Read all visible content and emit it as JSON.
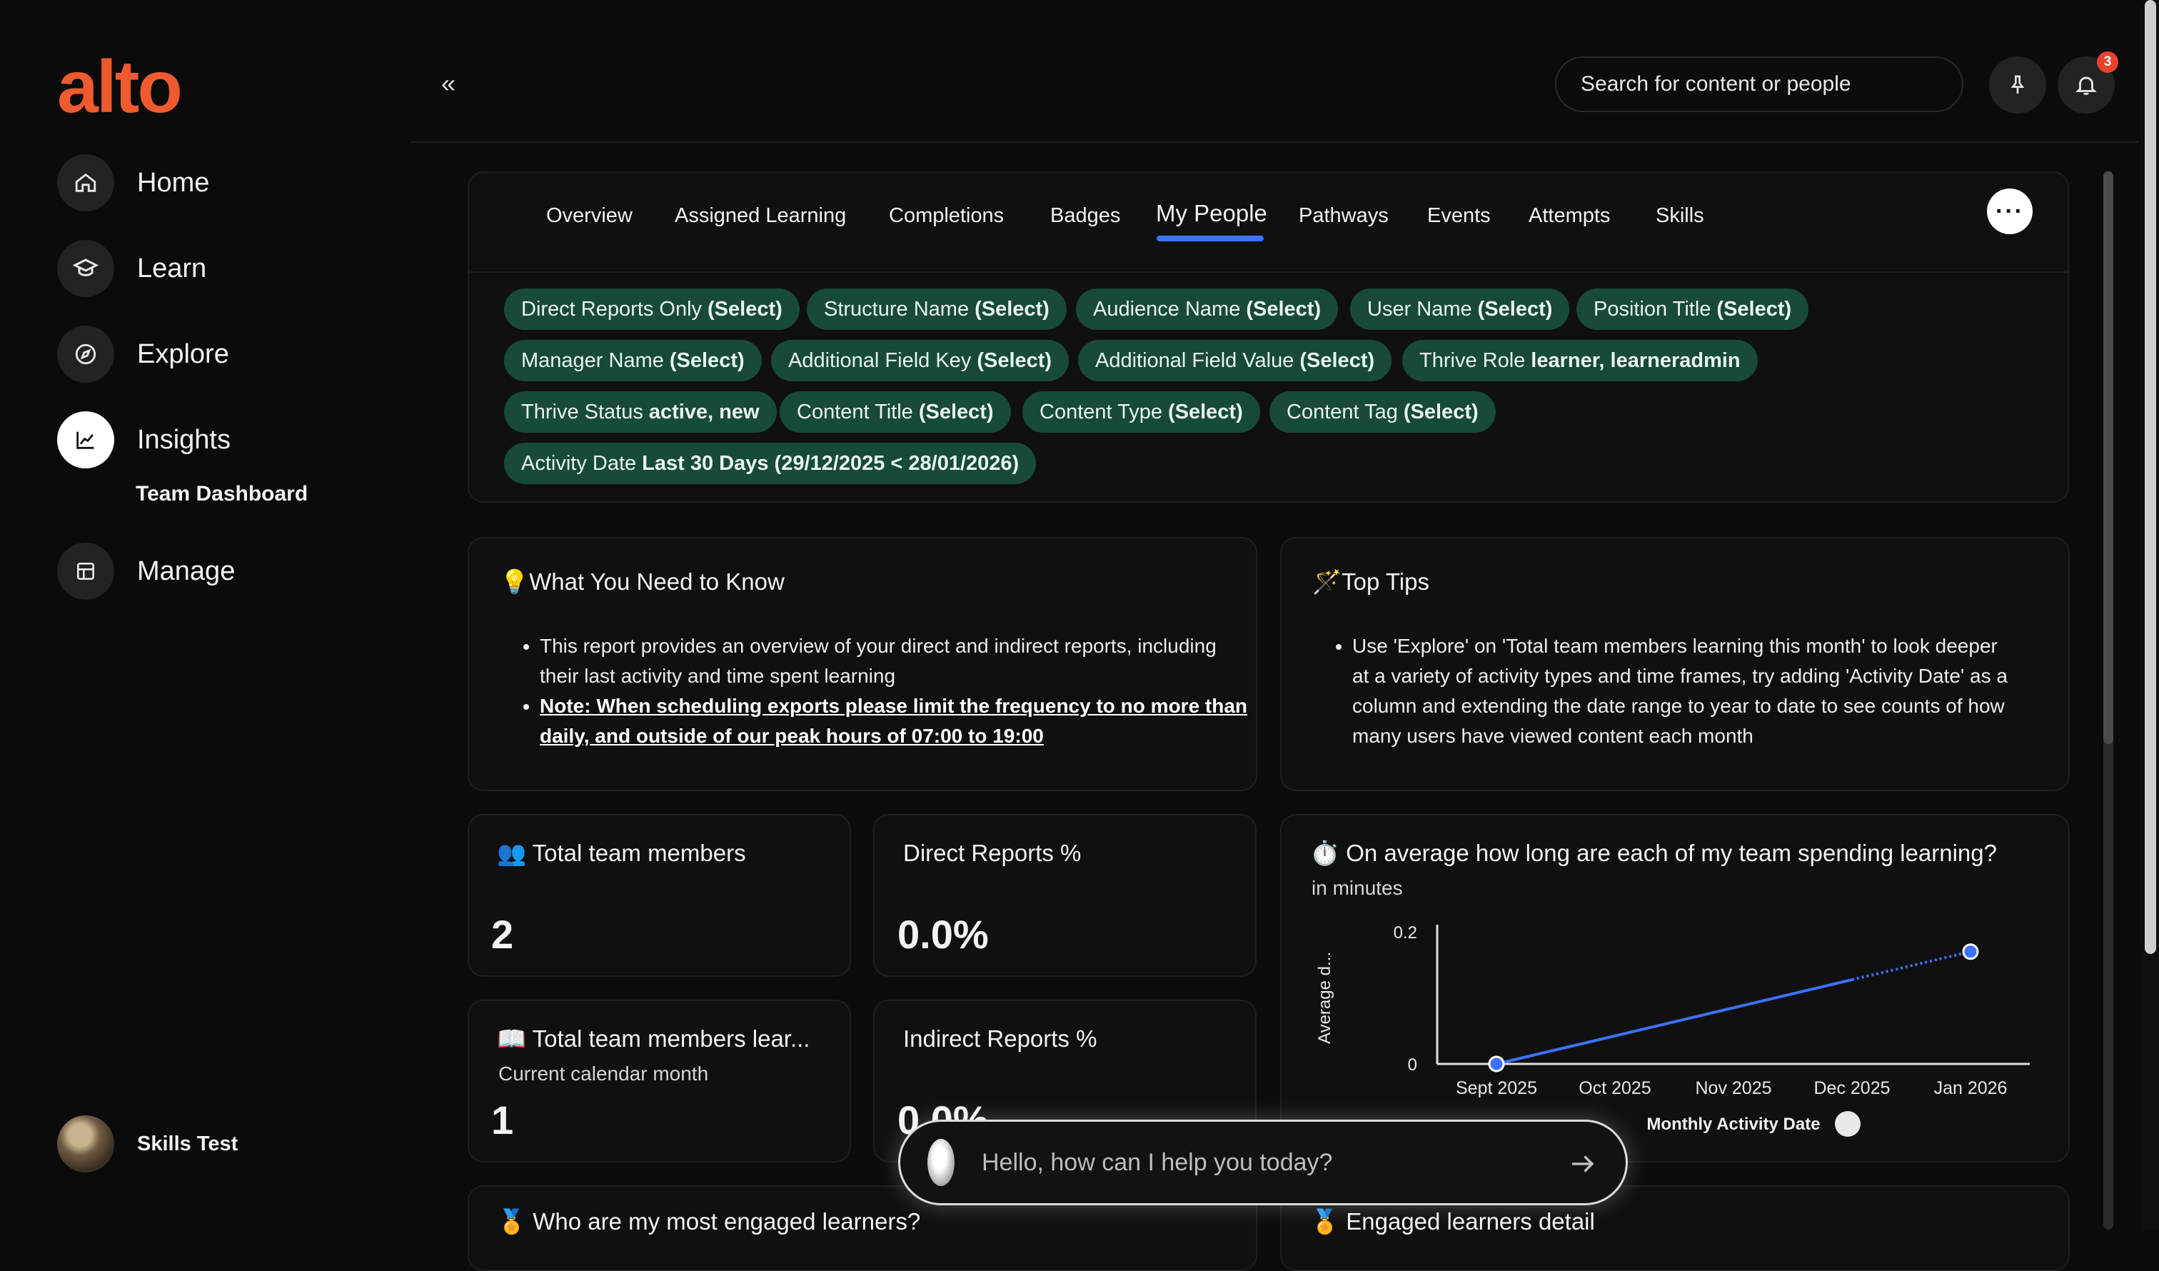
{
  "app": {
    "logo": "alto"
  },
  "sidebar": {
    "items": [
      {
        "label": "Home",
        "icon": "home-icon"
      },
      {
        "label": "Learn",
        "icon": "graduation-cap-icon"
      },
      {
        "label": "Explore",
        "icon": "compass-icon"
      },
      {
        "label": "Insights",
        "icon": "line-chart-icon",
        "active": true
      },
      {
        "label": "Manage",
        "icon": "grid-icon"
      }
    ],
    "subitem": "Team Dashboard",
    "user": {
      "name": "Skills Test"
    }
  },
  "header": {
    "collapse_icon": "«",
    "search_placeholder": "Search for content or people",
    "notification_count": "3"
  },
  "tabs": [
    {
      "label": "Overview"
    },
    {
      "label": "Assigned Learning"
    },
    {
      "label": "Completions"
    },
    {
      "label": "Badges"
    },
    {
      "label": "My People",
      "active": true
    },
    {
      "label": "Pathways"
    },
    {
      "label": "Events"
    },
    {
      "label": "Attempts"
    },
    {
      "label": "Skills"
    }
  ],
  "more_label": "···",
  "filters": [
    {
      "name": "Direct Reports Only",
      "value": "(Select)"
    },
    {
      "name": "Structure Name",
      "value": "(Select)"
    },
    {
      "name": "Audience Name",
      "value": "(Select)"
    },
    {
      "name": "User Name",
      "value": "(Select)"
    },
    {
      "name": "Position Title",
      "value": "(Select)"
    },
    {
      "name": "Manager Name",
      "value": "(Select)"
    },
    {
      "name": "Additional Field Key",
      "value": "(Select)"
    },
    {
      "name": "Additional Field Value",
      "value": "(Select)"
    },
    {
      "name": "Thrive Role",
      "value": "learner, learneradmin"
    },
    {
      "name": "Thrive Status",
      "value": "active, new"
    },
    {
      "name": "Content Title",
      "value": "(Select)"
    },
    {
      "name": "Content Type",
      "value": "(Select)"
    },
    {
      "name": "Content Tag",
      "value": "(Select)"
    },
    {
      "name": "Activity Date",
      "value": "Last 30 Days (29/12/2025 < 28/01/2026)"
    }
  ],
  "know": {
    "title": "💡What You Need to Know",
    "bullet1": "This report provides an overview of your direct and indirect reports, including their last activity and time spent learning",
    "bullet2": "Note: When scheduling exports please limit the frequency to no more than daily, and outside of our peak hours of 07:00 to 19:00"
  },
  "tips": {
    "title": "🪄Top Tips",
    "bullet1": "Use 'Explore' on 'Total team members learning this month' to look deeper at a variety of activity types and time frames, try adding 'Activity Date' as a column and extending the date range to year to date to see counts of how many users have viewed content each month"
  },
  "kpis": {
    "total_members": {
      "title": "👥 Total team members",
      "value": "2"
    },
    "direct_reports": {
      "title": "Direct Reports %",
      "value": "0.0%"
    },
    "members_learning": {
      "title": "📖 Total team members lear...",
      "subtitle": "Current calendar month",
      "value": "1"
    },
    "indirect_reports": {
      "title": "Indirect Reports %",
      "value": "0.0%"
    }
  },
  "time_chart": {
    "title": "⏱️ On average how long are each of my team spending learning?",
    "subtitle": "in minutes"
  },
  "chart_data": {
    "type": "line",
    "categories": [
      "Sept 2025",
      "Oct 2025",
      "Nov 2025",
      "Dec 2025",
      "Jan 2026"
    ],
    "series": [
      {
        "values": [
          0,
          null,
          null,
          null,
          0.17
        ]
      }
    ],
    "ylabel": "Average d...",
    "xlabel": "Monthly Activity Date",
    "ylim": [
      0,
      0.2
    ],
    "yticks": [
      "0",
      "0.2"
    ],
    "grid": false,
    "color": "#3b73ff"
  },
  "bottom": {
    "engaged_title": "🏅 Who are my most engaged learners?",
    "detail_title": "🏅 Engaged learners detail"
  },
  "chat": {
    "placeholder": "Hello, how can I help you today?"
  }
}
